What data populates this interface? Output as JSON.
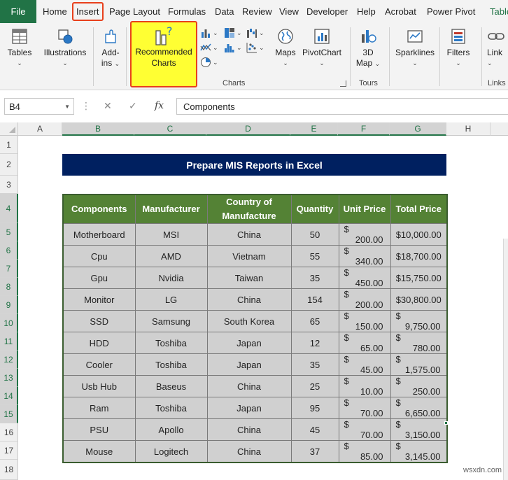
{
  "menu": {
    "file": "File",
    "tabs": [
      "Home",
      "Insert",
      "Page Layout",
      "Formulas",
      "Data",
      "Review",
      "View",
      "Developer",
      "Help",
      "Acrobat",
      "Power Pivot",
      "Table"
    ]
  },
  "ribbon": {
    "tables": "Tables",
    "illustrations": "Illustrations",
    "addins_line1": "Add-",
    "addins_line2": "ins",
    "recommended_line1": "Recommended",
    "recommended_line2": "Charts",
    "maps": "Maps",
    "pivotchart": "PivotChart",
    "map3d_line1": "3D",
    "map3d_line2": "Map",
    "sparklines": "Sparklines",
    "filters": "Filters",
    "links": "Link",
    "group_charts": "Charts",
    "group_tours": "Tours",
    "group_links": "Links"
  },
  "formula_bar": {
    "name_box": "B4",
    "fx": "fx",
    "formula": "Components"
  },
  "grid": {
    "columns": [
      "A",
      "B",
      "C",
      "D",
      "E",
      "F",
      "G",
      "H"
    ],
    "rows": [
      "1",
      "2",
      "3",
      "4",
      "5",
      "6",
      "7",
      "8",
      "9",
      "10",
      "11",
      "12",
      "13",
      "14",
      "15",
      "16",
      "17",
      "18"
    ]
  },
  "sheet": {
    "title": "Prepare MIS Reports in Excel",
    "headers": [
      "Components",
      "Manufacturer",
      "Country of Manufacture",
      "Quantity",
      "Unit Price",
      "Total Price"
    ],
    "rows": [
      {
        "component": "Motherboard",
        "manufacturer": "MSI",
        "country": "China",
        "quantity": "50",
        "unit_price": "200.00",
        "total": "$10,000.00"
      },
      {
        "component": "Cpu",
        "manufacturer": "AMD",
        "country": "Vietnam",
        "quantity": "55",
        "unit_price": "340.00",
        "total": "$18,700.00"
      },
      {
        "component": "Gpu",
        "manufacturer": "Nvidia",
        "country": "Taiwan",
        "quantity": "35",
        "unit_price": "450.00",
        "total": "$15,750.00"
      },
      {
        "component": "Monitor",
        "manufacturer": "LG",
        "country": "China",
        "quantity": "154",
        "unit_price": "200.00",
        "total": "$30,800.00"
      },
      {
        "component": "SSD",
        "manufacturer": "Samsung",
        "country": "South Korea",
        "quantity": "65",
        "unit_price": "150.00",
        "total_sym": "$",
        "total_val": "9,750.00"
      },
      {
        "component": "HDD",
        "manufacturer": "Toshiba",
        "country": "Japan",
        "quantity": "12",
        "unit_price": "65.00",
        "total_sym": "$",
        "total_val": "780.00"
      },
      {
        "component": "Cooler",
        "manufacturer": "Toshiba",
        "country": "Japan",
        "quantity": "35",
        "unit_price": "45.00",
        "total_sym": "$",
        "total_val": "1,575.00"
      },
      {
        "component": "Usb Hub",
        "manufacturer": "Baseus",
        "country": "China",
        "quantity": "25",
        "unit_price": "10.00",
        "total_sym": "$",
        "total_val": "250.00"
      },
      {
        "component": "Ram",
        "manufacturer": "Toshiba",
        "country": "Japan",
        "quantity": "95",
        "unit_price": "70.00",
        "total_sym": "$",
        "total_val": "6,650.00"
      },
      {
        "component": "PSU",
        "manufacturer": "Apollo",
        "country": "China",
        "quantity": "45",
        "unit_price": "70.00",
        "total_sym": "$",
        "total_val": "3,150.00"
      },
      {
        "component": "Mouse",
        "manufacturer": "Logitech",
        "country": "China",
        "quantity": "37",
        "unit_price": "85.00",
        "total_sym": "$",
        "total_val": "3,145.00"
      }
    ],
    "currency_symbol": "$"
  },
  "watermark": "wsxdn.com",
  "colors": {
    "excel_green": "#217346",
    "header_green": "#548235",
    "title_navy": "#002060",
    "highlight_yellow": "#ffff33",
    "highlight_border": "#e8401c"
  }
}
